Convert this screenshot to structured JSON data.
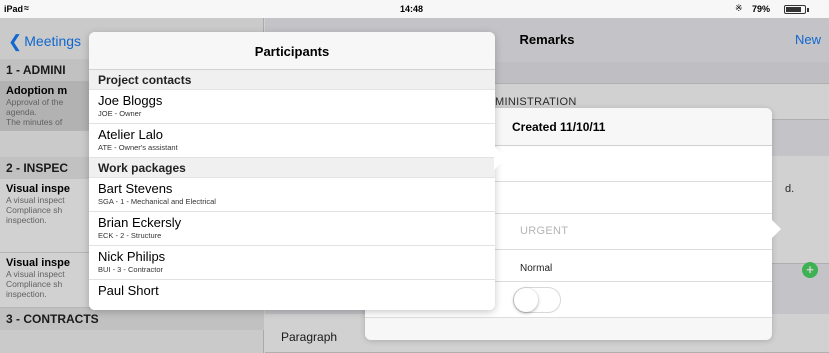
{
  "status_bar": {
    "device": "iPad",
    "wifi_icon": "wifi-icon",
    "time": "14:48",
    "bluetooth_icon": "bluetooth-icon",
    "battery_percent": "79%"
  },
  "left_pane": {
    "back_label": "Meetings",
    "sections": [
      {
        "title": "1 - ADMINI",
        "items": [
          {
            "title": "Adoption m",
            "lines": [
              "Approval of the",
              "agenda.",
              "The minutes of"
            ],
            "selected": true
          }
        ]
      },
      {
        "title": "2 - INSPEC",
        "items": [
          {
            "title": "Visual inspe",
            "lines": [
              "A visual inspect",
              "Compliance sh",
              "inspection."
            ]
          },
          {
            "title": "Visual inspe",
            "lines": [
              "A visual inspect",
              "Compliance sh",
              "inspection."
            ]
          }
        ]
      },
      {
        "title": "3 - CONTRACTS",
        "items": []
      }
    ]
  },
  "right_pane": {
    "title": "Remarks",
    "new_label": "New",
    "admin_heading": "MINISTRATION",
    "fragment": "d.",
    "paragraph_label": "Paragraph",
    "add_icon": "plus-icon"
  },
  "created_popover": {
    "title": "Created 11/10/11",
    "urgent_label": "URGENT",
    "normal_label": "Normal",
    "toggle_on": false
  },
  "participants_popover": {
    "title": "Participants",
    "groups": [
      {
        "name": "Project contacts",
        "contacts": [
          {
            "name": "Joe Bloggs",
            "role": "JOE - Owner"
          },
          {
            "name": "Atelier Lalo",
            "role": "ATE - Owner's assistant"
          }
        ]
      },
      {
        "name": "Work packages",
        "contacts": [
          {
            "name": "Bart Stevens",
            "role": "SGA - 1 - Mechanical and Electrical"
          },
          {
            "name": "Brian Eckersly",
            "role": "ECK - 2 - Structure"
          },
          {
            "name": "Nick Philips",
            "role": "BUI - 3 - Contractor"
          },
          {
            "name": "Paul Short",
            "role": ""
          }
        ]
      }
    ]
  }
}
